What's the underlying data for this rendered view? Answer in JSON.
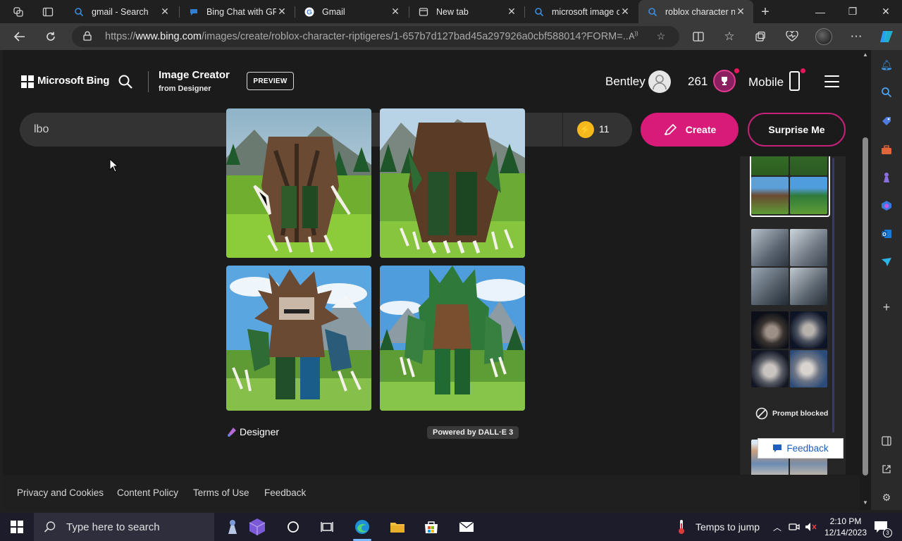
{
  "browser": {
    "tabs": [
      {
        "title": "gmail - Search",
        "icon": "bing-search-icon"
      },
      {
        "title": "Bing Chat with GP",
        "icon": "bing-chat-icon"
      },
      {
        "title": "Gmail",
        "icon": "google-icon"
      },
      {
        "title": "New tab",
        "icon": "new-tab-page-icon"
      },
      {
        "title": "microsoft image c",
        "icon": "bing-search-icon"
      },
      {
        "title": "roblox character n",
        "icon": "bing-search-icon",
        "active": true
      }
    ],
    "url_prefix": "https://",
    "url_domain": "www.bing.com",
    "url_path": "/images/create/roblox-character-riptigeres/1-657b7d127bad45a297926a0cbf588014?FORM=..."
  },
  "header": {
    "brand": "Microsoft Bing",
    "product_title": "Image Creator",
    "product_sub": "from Designer",
    "preview_badge": "PREVIEW",
    "user_name": "Bentley",
    "points": "261",
    "mobile_label": "Mobile"
  },
  "prompt": {
    "value": "lbo",
    "boosts": "11",
    "create_label": "Create",
    "surprise_label": "Surprise Me"
  },
  "results": {
    "designer_label": "Designer",
    "powered_by": "Powered by DALL·E 3"
  },
  "history": {
    "blocked_label": "Prompt blocked"
  },
  "footer": {
    "links": [
      "Privacy and Cookies",
      "Content Policy",
      "Terms of Use",
      "Feedback"
    ],
    "feedback_button": "Feedback"
  },
  "taskbar": {
    "search_placeholder": "Type here to search",
    "weather": "Temps to jump",
    "time": "2:10 PM",
    "date": "12/14/2023",
    "notification_count": "3"
  },
  "colors": {
    "accent_pink": "#d81b79",
    "page_bg": "#1b1b1b",
    "boost_gold": "#f5b81d"
  }
}
